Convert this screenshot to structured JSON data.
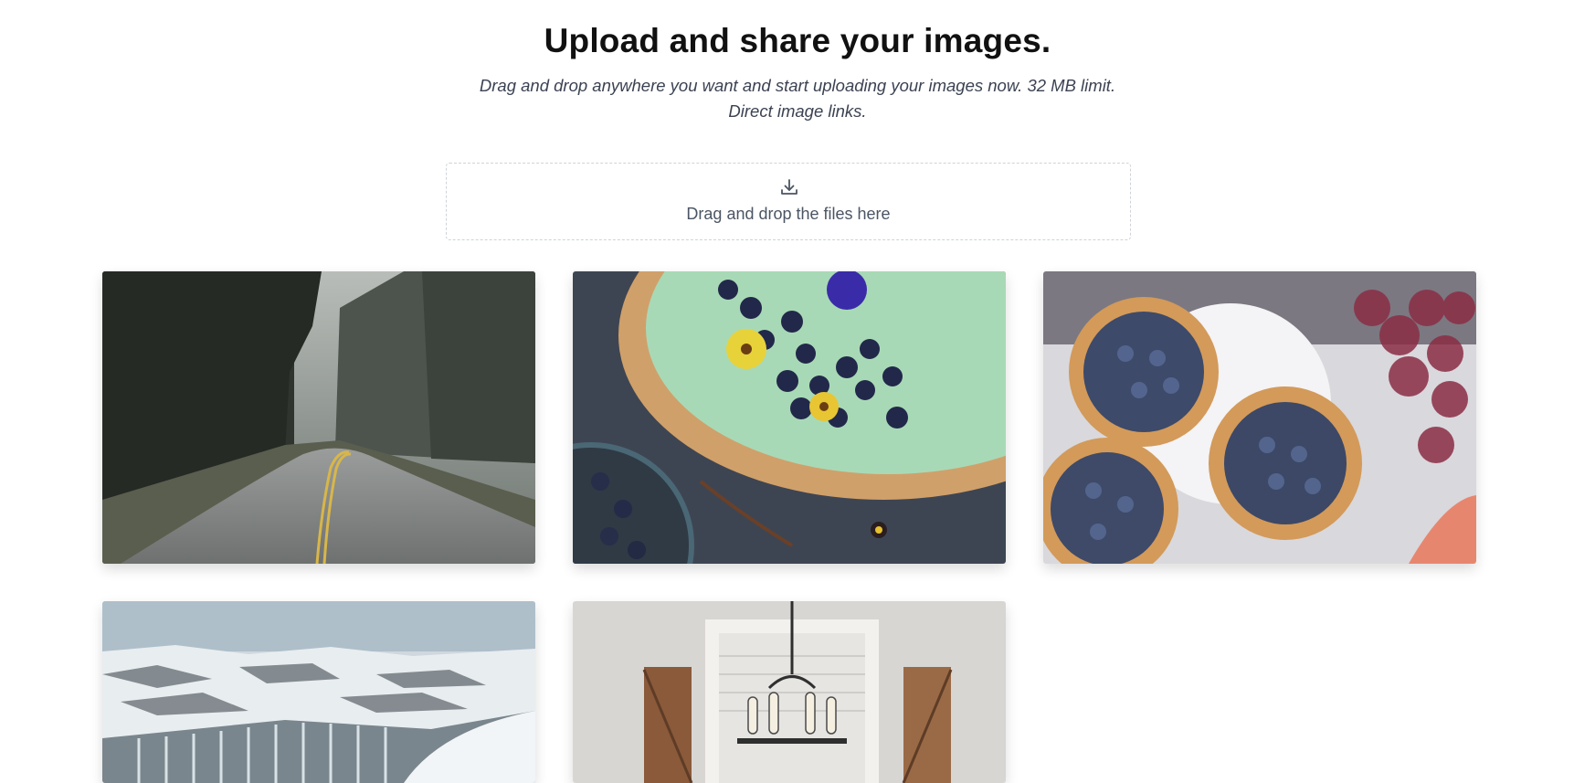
{
  "hero": {
    "title": "Upload and share your images.",
    "subtitle_line1": "Drag and drop anywhere you want and start uploading your images now. 32 MB limit.",
    "subtitle_line2": "Direct image links."
  },
  "dropzone": {
    "icon": "download-icon",
    "label": "Drag and drop the files here"
  },
  "gallery": {
    "items": [
      {
        "alt": "forest-road",
        "icon": "image"
      },
      {
        "alt": "berry-tart",
        "icon": "image"
      },
      {
        "alt": "blueberry-tartlets",
        "icon": "image"
      },
      {
        "alt": "snowy-waterfall",
        "icon": "image"
      },
      {
        "alt": "chandelier-window",
        "icon": "image"
      }
    ]
  },
  "colors": {
    "title": "#111111",
    "subtitle": "#3b4252",
    "dropzone_border": "#cfd3d8",
    "dropzone_text": "#4b5563"
  }
}
